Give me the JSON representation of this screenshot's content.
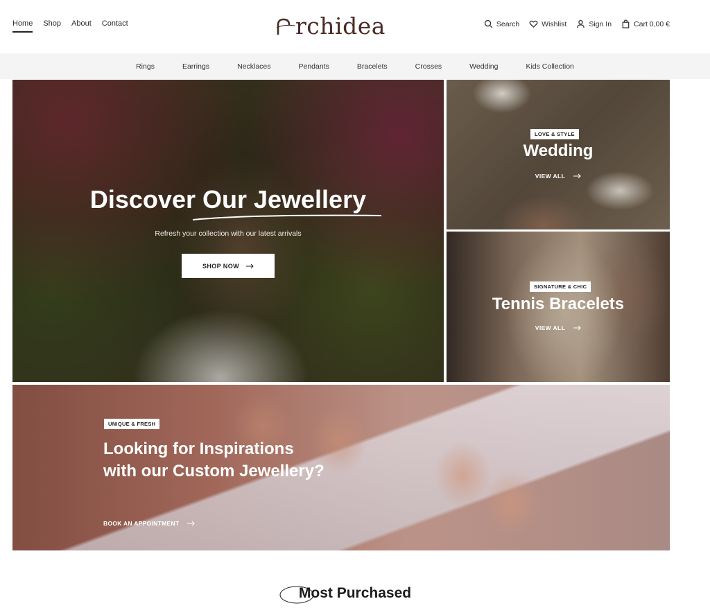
{
  "header": {
    "nav_left": [
      {
        "label": "Home",
        "active": true
      },
      {
        "label": "Shop"
      },
      {
        "label": "About"
      },
      {
        "label": "Contact"
      }
    ],
    "logo_text": "rchidea",
    "nav_right": {
      "search": "Search",
      "wishlist": "Wishlist",
      "sign_in": "Sign In",
      "cart": "Cart 0,00 €"
    }
  },
  "categories": [
    "Rings",
    "Earrings",
    "Necklaces",
    "Pendants",
    "Bracelets",
    "Crosses",
    "Wedding",
    "Kids Collection"
  ],
  "hero": {
    "title": "Discover Our Jewellery",
    "subtitle": "Refresh your collection with our latest arrivals",
    "button": "SHOP NOW"
  },
  "cards": [
    {
      "tag": "LOVE & STYLE",
      "title": "Wedding",
      "cta": "VIEW ALL"
    },
    {
      "tag": "SIGNATURE & CHIC",
      "title": "Tennis Bracelets",
      "cta": "VIEW ALL"
    }
  ],
  "banner": {
    "tag": "UNIQUE & FRESH",
    "title": "Looking for Inspirations with our Custom Jewellery?",
    "cta": "BOOK AN APPOINTMENT"
  },
  "section": {
    "title": "Most Purchased"
  },
  "colors": {
    "brand": "#4b2b24",
    "category_bar_bg": "#f4f4f4"
  }
}
